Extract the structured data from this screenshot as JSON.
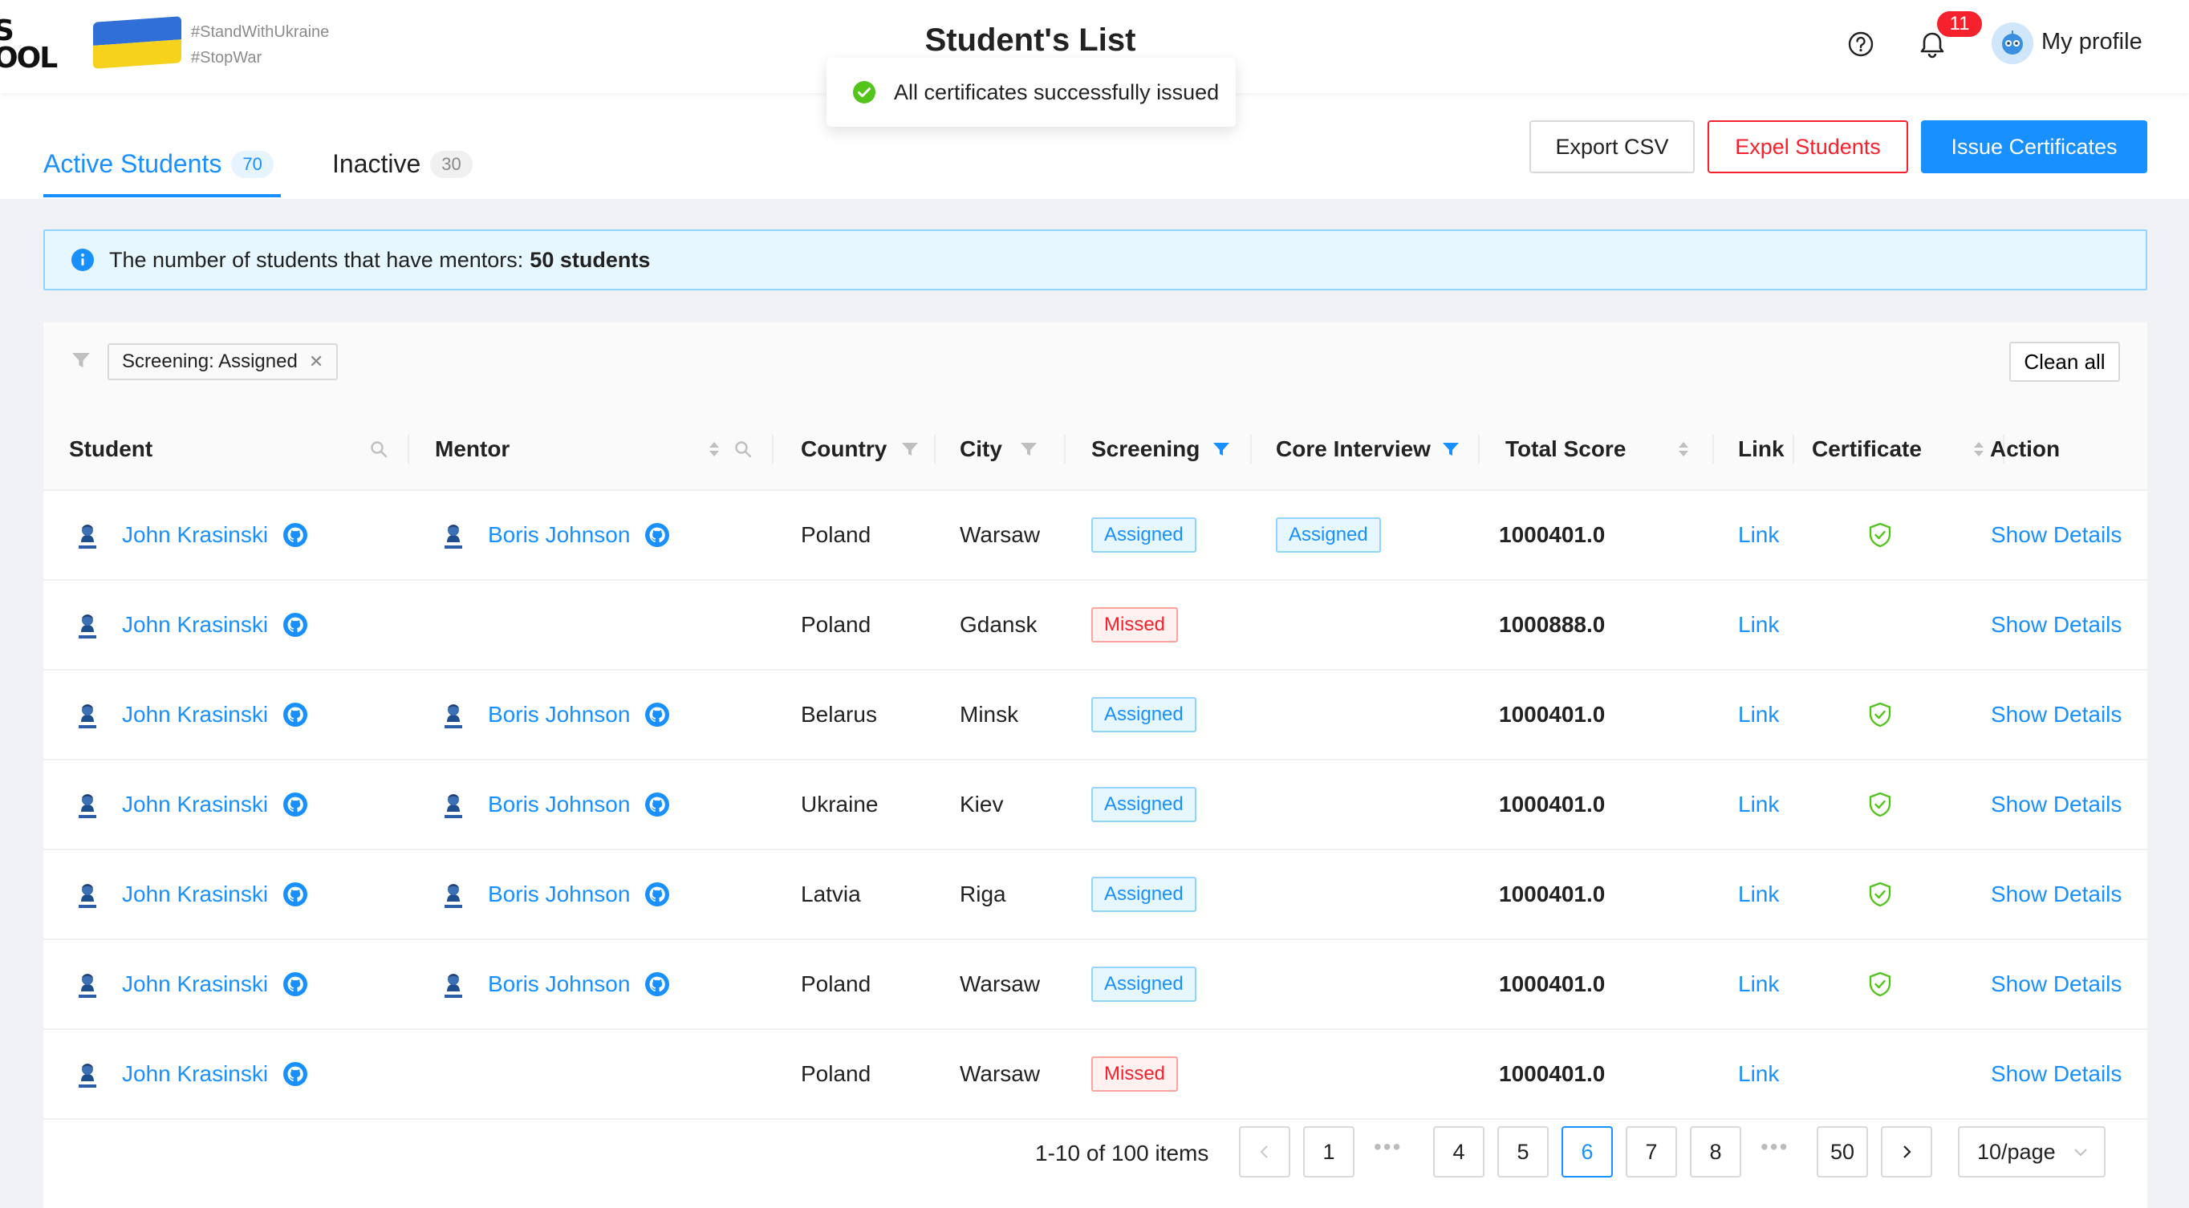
{
  "header": {
    "logo_text": "S\nOOL",
    "hashtags": [
      "#StandWithUkraine",
      "#StopWar"
    ],
    "title": "Student's List",
    "notification_count": "11",
    "profile_label": "My profile"
  },
  "toast": {
    "message": "All certificates successfully issued"
  },
  "tabs": [
    {
      "label": "Active Students",
      "count": "70",
      "active": true
    },
    {
      "label": "Inactive",
      "count": "30",
      "active": false
    }
  ],
  "actions": {
    "export": "Export CSV",
    "expel": "Expel Students",
    "issue": "Issue Certificates"
  },
  "alert": {
    "text": "The number of students that have mentors:",
    "value": "50 students"
  },
  "filters": {
    "tag_label": "Screening: Assigned",
    "clean_all": "Clean all"
  },
  "columns": {
    "student": "Student",
    "mentor": "Mentor",
    "country": "Country",
    "city": "City",
    "screening": "Screening",
    "core_interview": "Core Interview",
    "total_score": "Total Score",
    "link": "Link",
    "certificate": "Certificate",
    "action": "Action"
  },
  "rows": [
    {
      "student": "John Krasinski",
      "mentor": "Boris Johnson",
      "country": "Poland",
      "city": "Warsaw",
      "screening": "Assigned",
      "core": "Assigned",
      "score": "1000401.0",
      "link": "Link",
      "certificate": true,
      "action": "Show Details"
    },
    {
      "student": "John Krasinski",
      "mentor": "",
      "country": "Poland",
      "city": "Gdansk",
      "screening": "Missed",
      "core": "",
      "score": "1000888.0",
      "link": "Link",
      "certificate": false,
      "action": "Show Details"
    },
    {
      "student": "John Krasinski",
      "mentor": "Boris Johnson",
      "country": "Belarus",
      "city": "Minsk",
      "screening": "Assigned",
      "core": "",
      "score": "1000401.0",
      "link": "Link",
      "certificate": true,
      "action": "Show Details"
    },
    {
      "student": "John Krasinski",
      "mentor": "Boris Johnson",
      "country": "Ukraine",
      "city": "Kiev",
      "screening": "Assigned",
      "core": "",
      "score": "1000401.0",
      "link": "Link",
      "certificate": true,
      "action": "Show Details"
    },
    {
      "student": "John Krasinski",
      "mentor": "Boris Johnson",
      "country": "Latvia",
      "city": "Riga",
      "screening": "Assigned",
      "core": "",
      "score": "1000401.0",
      "link": "Link",
      "certificate": true,
      "action": "Show Details"
    },
    {
      "student": "John Krasinski",
      "mentor": "Boris Johnson",
      "country": "Poland",
      "city": "Warsaw",
      "screening": "Assigned",
      "core": "",
      "score": "1000401.0",
      "link": "Link",
      "certificate": true,
      "action": "Show Details"
    },
    {
      "student": "John Krasinski",
      "mentor": "",
      "country": "Poland",
      "city": "Warsaw",
      "screening": "Missed",
      "core": "",
      "score": "1000401.0",
      "link": "Link",
      "certificate": false,
      "action": "Show Details"
    }
  ],
  "pagination": {
    "total_text": "1-10 of 100 items",
    "pages": [
      "1",
      "•••",
      "4",
      "5",
      "6",
      "7",
      "8",
      "•••",
      "50"
    ],
    "current": "6",
    "page_size": "10/page"
  },
  "colors": {
    "accent": "#1890ff",
    "danger": "#f5222d",
    "success": "#52c41a",
    "flag_blue": "#2f6fd6",
    "flag_yellow": "#f7d21d"
  },
  "icons": {
    "help": "question-circle-icon",
    "bell": "bell-icon",
    "success": "check-circle-icon",
    "info": "info-circle-icon",
    "filter": "filter-icon",
    "search": "search-icon",
    "sort": "sort-icon",
    "github": "github-icon",
    "certificate": "shield-check-icon",
    "prev": "chevron-left-icon",
    "next": "chevron-right-icon"
  }
}
